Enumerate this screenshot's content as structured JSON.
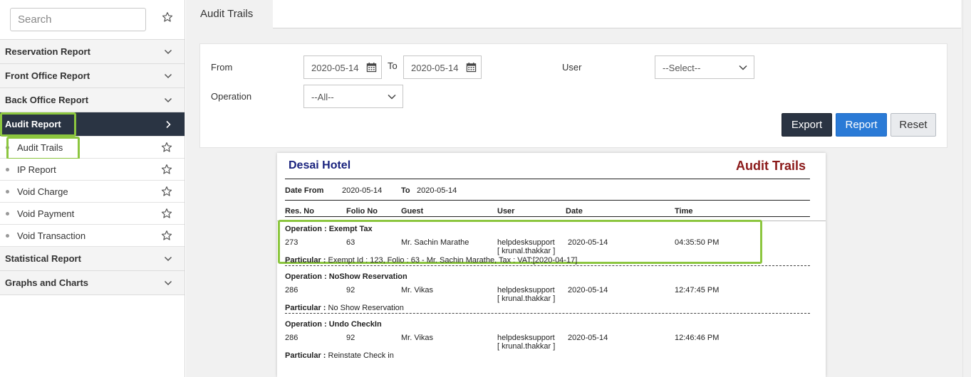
{
  "search": {
    "placeholder": "Search"
  },
  "sidebar": {
    "groups": [
      {
        "label": "Reservation Report"
      },
      {
        "label": "Front Office Report"
      },
      {
        "label": "Back Office Report"
      },
      {
        "label": "Audit Report"
      },
      {
        "label": "Statistical Report"
      },
      {
        "label": "Graphs and Charts"
      }
    ],
    "audit_items": [
      {
        "label": "Audit Trails"
      },
      {
        "label": "IP Report"
      },
      {
        "label": "Void Charge"
      },
      {
        "label": "Void Payment"
      },
      {
        "label": "Void Transaction"
      }
    ]
  },
  "tab": {
    "label": "Audit Trails"
  },
  "filters": {
    "from_label": "From",
    "from_value": "2020-05-14",
    "to_label": "To",
    "to_value": "2020-05-14",
    "user_label": "User",
    "user_value": "--Select--",
    "operation_label": "Operation",
    "operation_value": "--All--"
  },
  "buttons": {
    "export": "Export",
    "report": "Report",
    "reset": "Reset"
  },
  "report": {
    "hotel": "Desai Hotel",
    "title": "Audit Trails",
    "date_from_label": "Date From",
    "date_from": "2020-05-14",
    "to_label": "To",
    "date_to": "2020-05-14",
    "headers": {
      "res_no": "Res. No",
      "folio_no": "Folio No",
      "guest": "Guest",
      "user": "User",
      "date": "Date",
      "time": "Time"
    },
    "particular_label": "Particular :",
    "entries": [
      {
        "operation": "Operation : Exempt Tax",
        "res_no": "273",
        "folio_no": "63",
        "guest": "Mr. Sachin Marathe",
        "user": "helpdesksupport",
        "user_sub": "[ krunal.thakkar ]",
        "date": "2020-05-14",
        "time": "04:35:50 PM",
        "particular": "Exempt Id : 123, Folio : 63 - Mr. Sachin Marathe, Tax : VAT:[2020-04-17]"
      },
      {
        "operation": "Operation : NoShow Reservation",
        "res_no": "286",
        "folio_no": "92",
        "guest": "Mr. Vikas",
        "user": "helpdesksupport",
        "user_sub": "[ krunal.thakkar ]",
        "date": "2020-05-14",
        "time": "12:47:45 PM",
        "particular": "No Show Reservation"
      },
      {
        "operation": "Operation : Undo CheckIn",
        "res_no": "286",
        "folio_no": "92",
        "guest": "Mr. Vikas",
        "user": "helpdesksupport",
        "user_sub": "[ krunal.thakkar ]",
        "date": "2020-05-14",
        "time": "12:46:46 PM",
        "particular": "Reinstate Check in"
      }
    ]
  }
}
